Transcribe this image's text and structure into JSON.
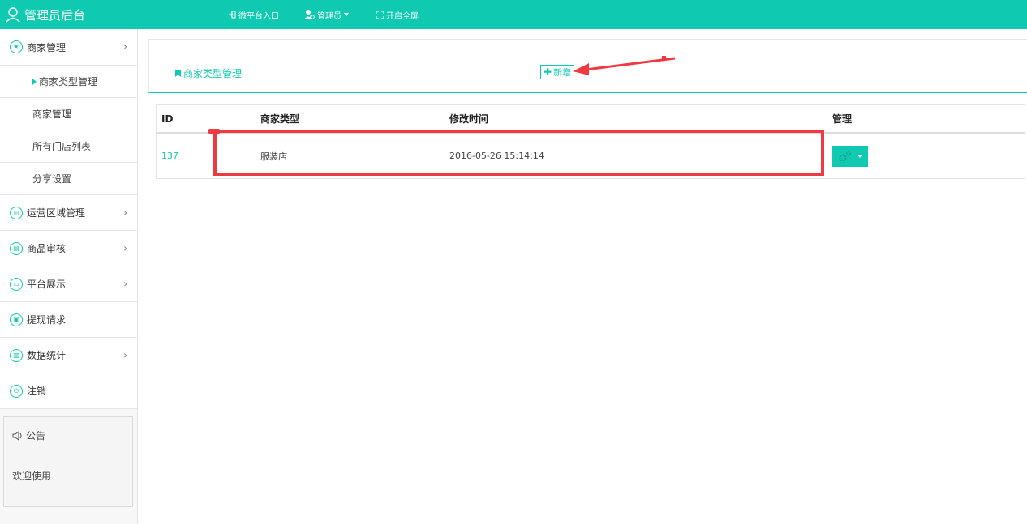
{
  "header": {
    "brand": "管理员后台",
    "nav": [
      {
        "label": "微平台入口",
        "icon": "signin-icon"
      },
      {
        "label": "管理员",
        "icon": "admin-user-icon"
      },
      {
        "label": "开启全屏",
        "icon": "fullscreen-icon"
      }
    ]
  },
  "sidebar": {
    "sections": [
      {
        "label": "商家管理",
        "icon": "star-icon",
        "chevron": "›"
      },
      {
        "label": "运营区域管理",
        "icon": "location-icon",
        "chevron": "›"
      },
      {
        "label": "商品审核",
        "icon": "document-icon",
        "chevron": "›"
      },
      {
        "label": "平台展示",
        "icon": "display-icon",
        "chevron": "›"
      },
      {
        "label": "提现请求",
        "icon": "wallet-icon"
      },
      {
        "label": "数据统计",
        "icon": "chart-icon",
        "chevron": "›"
      },
      {
        "label": "注销",
        "icon": "power-icon"
      }
    ],
    "subitems": [
      "商家类型管理",
      "商家管理",
      "所有门店列表",
      "分享设置"
    ],
    "notice": {
      "title": "公告",
      "body": "欢迎使用"
    }
  },
  "main": {
    "panel_title": "商家类型管理",
    "add_label": "新增",
    "table": {
      "headers": [
        "ID",
        "商家类型",
        "修改时间",
        "管理"
      ],
      "rows": [
        {
          "id": "137",
          "type": "服装店",
          "modified": "2016-05-26 15:14:14"
        }
      ]
    }
  },
  "colors": {
    "accent": "#0fc9b0",
    "annotation": "#ee3a43"
  }
}
